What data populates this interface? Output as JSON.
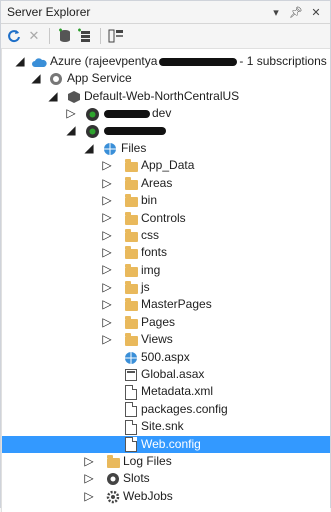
{
  "window": {
    "title": "Server Explorer",
    "controls": [
      "dropdown",
      "pin",
      "close"
    ]
  },
  "toolbar": {
    "buttons": [
      "refresh",
      "stop",
      "connect-database",
      "connect-server",
      "sharepoint-connections"
    ]
  },
  "tree": {
    "azure_label_prefix": "Azure (rajeevpentya",
    "azure_label_suffix": "- 1 subscriptions",
    "app_service": "App Service",
    "resource_group": "Default-Web-NorthCentralUS",
    "site1_suffix": "dev",
    "files": "Files",
    "folders": [
      "App_Data",
      "Areas",
      "bin",
      "Controls",
      "css",
      "fonts",
      "img",
      "js",
      "MasterPages",
      "Pages",
      "Views"
    ],
    "file_items": [
      "500.aspx",
      "Global.asax",
      "Metadata.xml",
      "packages.config",
      "Site.snk",
      "Web.config"
    ],
    "selected_file": "Web.config",
    "log_files": "Log Files",
    "slots": "Slots",
    "webjobs": "WebJobs"
  }
}
